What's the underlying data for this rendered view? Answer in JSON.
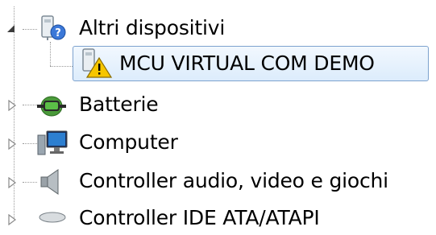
{
  "tree": {
    "items": [
      {
        "label": "Altri dispositivi",
        "expanded": true,
        "icon": "unknown-device-icon"
      },
      {
        "label": "MCU VIRTUAL COM DEMO",
        "child": true,
        "selected": true,
        "icon": "warning-device-icon"
      },
      {
        "label": "Batterie",
        "expanded": false,
        "icon": "battery-icon"
      },
      {
        "label": "Computer",
        "expanded": false,
        "icon": "computer-icon"
      },
      {
        "label": "Controller audio, video e giochi",
        "expanded": false,
        "icon": "speaker-icon"
      },
      {
        "label": "Controller IDE ATA/ATAPI",
        "expanded": false,
        "icon": "ide-controller-icon"
      }
    ]
  },
  "colors": {
    "selection_border": "#7da2ce",
    "selection_fill": "#dcecfc",
    "warning": "#f7c600"
  }
}
